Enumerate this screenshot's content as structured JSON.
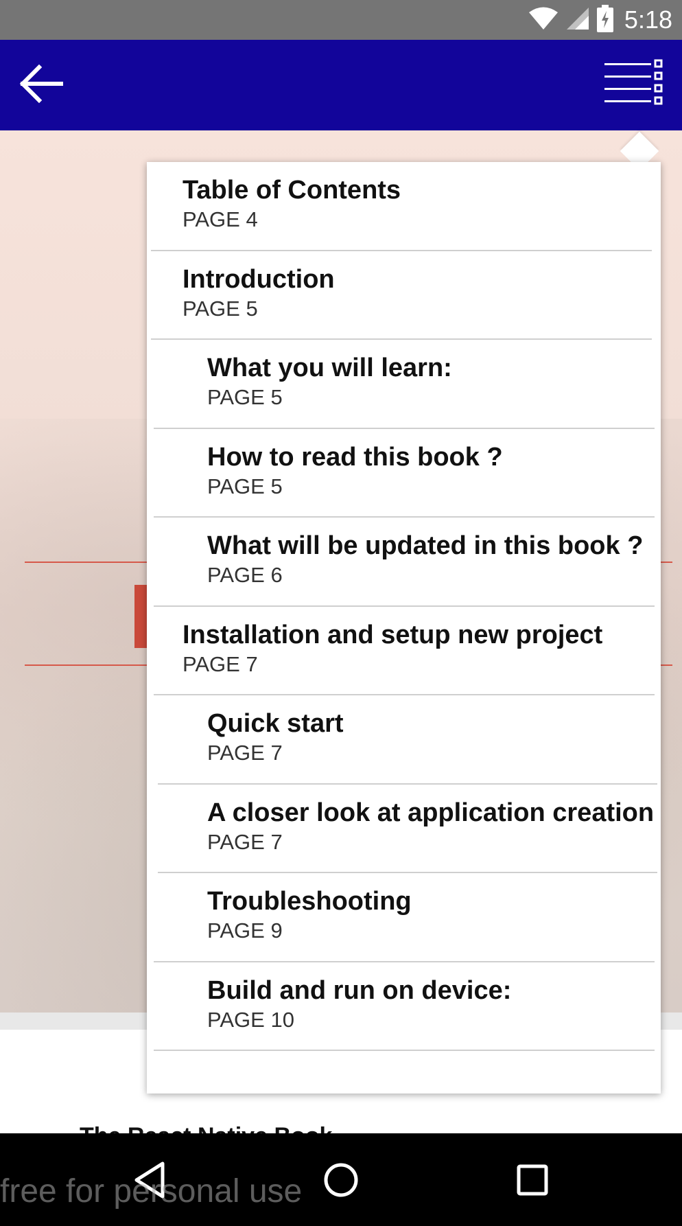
{
  "status_bar": {
    "time": "5:18",
    "icons": [
      "wifi-icon",
      "cell-signal-icon",
      "battery-icon"
    ]
  },
  "app_bar": {
    "back_icon": "arrow-left-icon",
    "toc_icon": "table-of-contents-icon",
    "color": "#12059a"
  },
  "toc": {
    "items": [
      {
        "title": "Table of Contents",
        "page": "PAGE 4",
        "level": 0
      },
      {
        "title": "Introduction",
        "page": "PAGE 5",
        "level": 0
      },
      {
        "title": "What you will learn:",
        "page": "PAGE 5",
        "level": 1
      },
      {
        "title": "How to read this book ?",
        "page": "PAGE 5",
        "level": 1
      },
      {
        "title": "What will be updated in this book ?",
        "page": "PAGE 6",
        "level": 1
      },
      {
        "title": "Installation and setup new project",
        "page": "PAGE 7",
        "level": 0
      },
      {
        "title": "Quick start",
        "page": "PAGE 7",
        "level": 1
      },
      {
        "title": "A closer look at application creation",
        "page": "PAGE 7",
        "level": 1
      },
      {
        "title": "Troubleshooting",
        "page": "PAGE 9",
        "level": 1
      },
      {
        "title": "Build and run on device:",
        "page": "PAGE 10",
        "level": 1
      }
    ]
  },
  "page": {
    "partial_title": "The React Native Book"
  },
  "watermark": "free for personal use",
  "nav_bar": {
    "icons": [
      "back-triangle-icon",
      "home-circle-icon",
      "recents-square-icon"
    ]
  }
}
